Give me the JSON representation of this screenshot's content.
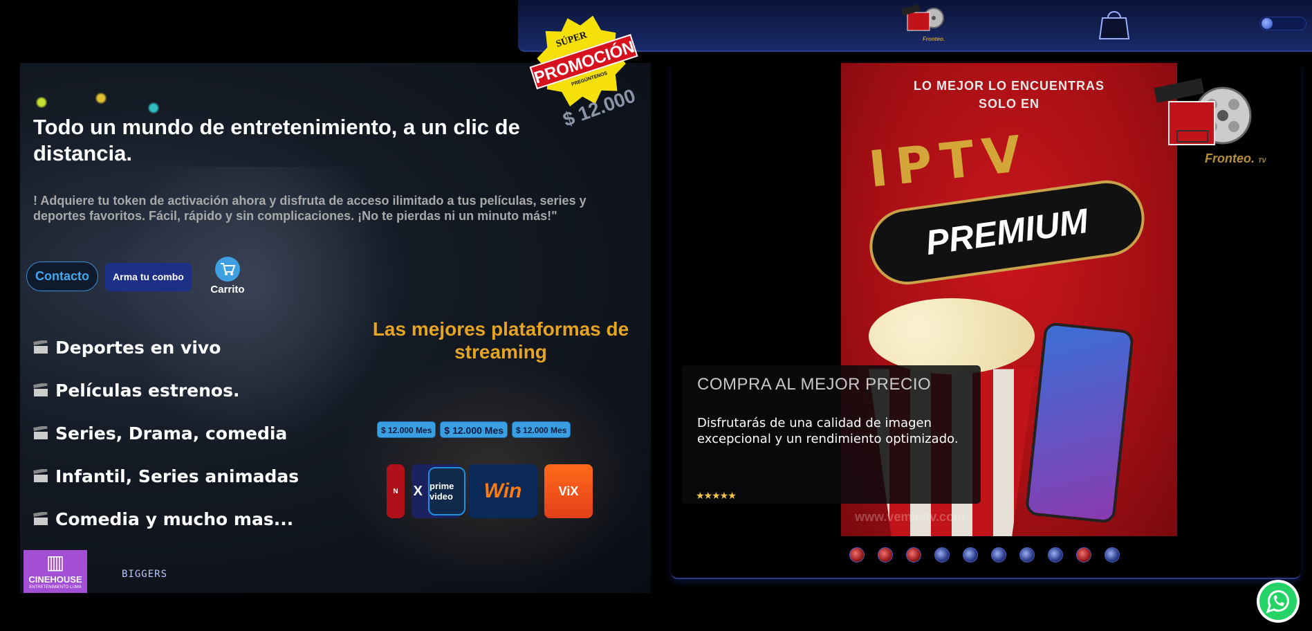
{
  "topbar": {
    "logo_icon": "film-reel-popcorn-logo",
    "logo_text": "Fronteo.",
    "logo_tv": "TV",
    "cart_icon": "shopping-bag-icon",
    "theme_toggle": "toggle-switch"
  },
  "promo": {
    "super": "SÚPER",
    "label": "PROMOCIÓN",
    "pregunta": "PREGÚNTENOS",
    "price": "$ 12.000"
  },
  "hero": {
    "title": "Todo un mundo de entretenimiento, a un clic de distancia.",
    "description": "! Adquiere tu token de activación ahora y disfruta de acceso ilimitado a tus películas, series y deportes favoritos. Fácil, rápido y sin complicaciones. ¡No te pierdas ni un minuto más!\"",
    "contacto_label": "Contacto",
    "combo_label": "Arma tu combo",
    "cart_label": "Carrito"
  },
  "features": [
    "Deportes en vivo",
    "Películas estrenos.",
    "Series, Drama, comedia",
    "Infantil, Series animadas",
    "Comedia y mucho mas..."
  ],
  "platforms": {
    "title": "Las mejores plataformas de streaming",
    "prices": [
      "$ 12.000 Mes",
      "$ 12.000 Mes",
      "$ 12.000 Mes"
    ],
    "logos": [
      {
        "name": "netflix",
        "text": "N"
      },
      {
        "name": "max",
        "text": "X"
      },
      {
        "name": "prime-video",
        "text": "prime video"
      },
      {
        "name": "win",
        "text": "Win"
      },
      {
        "name": "vix",
        "text": "ViX"
      }
    ]
  },
  "footer_logos": {
    "cinehouse": "CINEHOUSE",
    "cinehouse_sub": "ENTRETENIMIENTO LUMA",
    "biggers": "BIGGERS"
  },
  "poster": {
    "header_line1": "LO MEJOR LO ENCUENTRAS",
    "header_line2": "SOLO EN",
    "iptv": "IPTV",
    "premium": "PREMIUM",
    "footer": "www.vemastv.com"
  },
  "brand": {
    "name": "Fronteo.",
    "suffix": "TV"
  },
  "card": {
    "title": "COMPRA AL MEJOR PRECIO",
    "description": "Disfrutarás de una calidad de imagen excepcional y un rendimiento optimizado.",
    "stars": "★★★★★"
  },
  "carousel": {
    "dot_count": 10
  },
  "colors": {
    "accent_blue": "#3a9fe0",
    "accent_gold": "#e5a523",
    "promo_red": "#d5121e",
    "promo_yellow": "#f5e00a",
    "nav_blue": "#1a2a6a"
  }
}
